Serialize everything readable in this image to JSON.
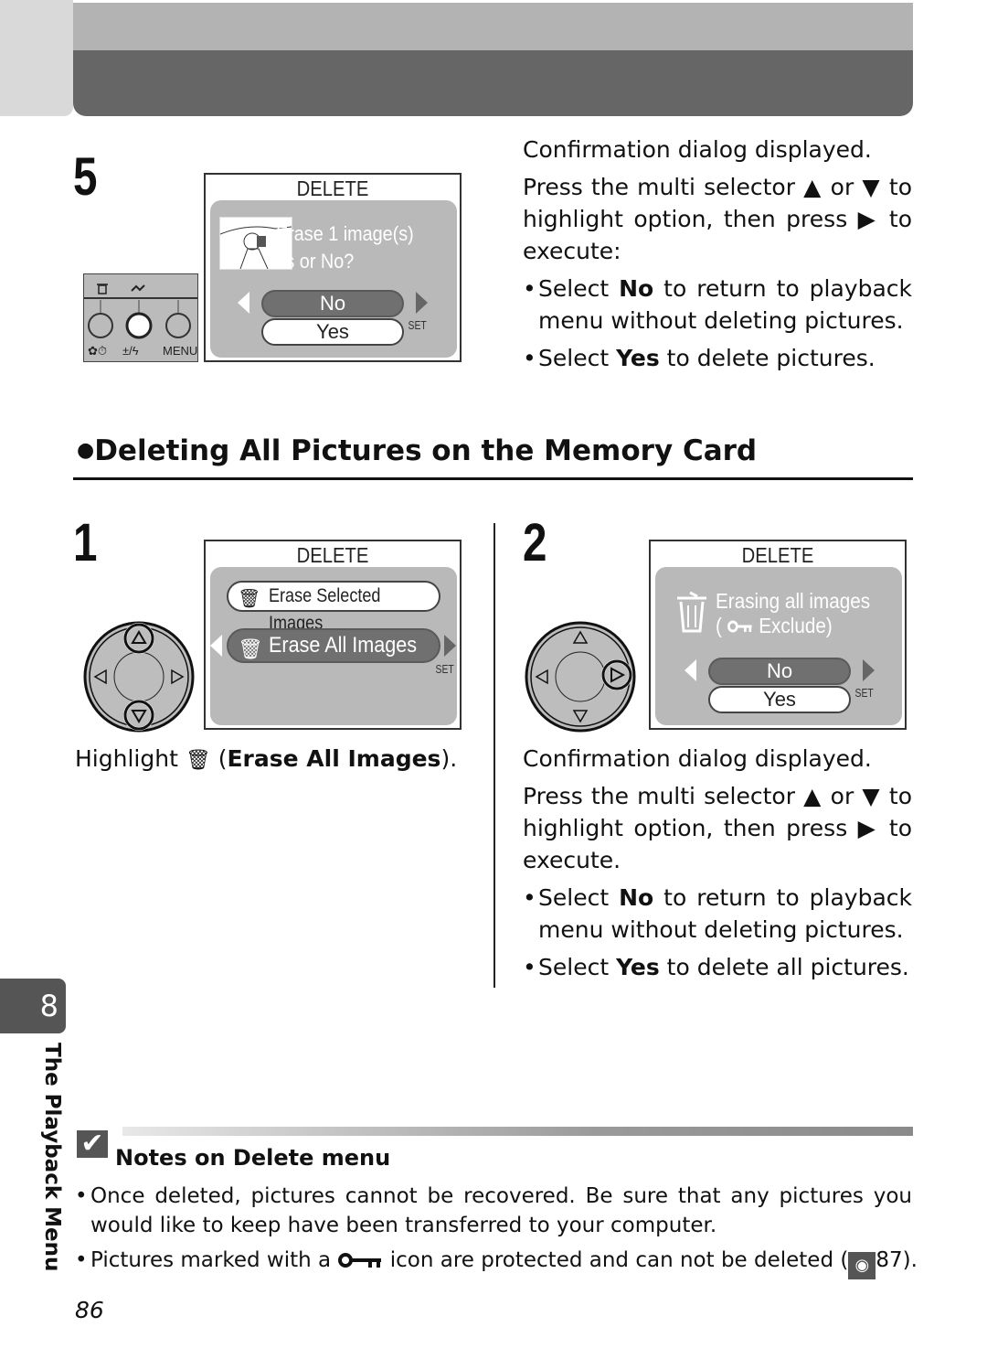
{
  "page": {
    "page_number": "86",
    "chapter_tab": "8",
    "chapter_label": "The Playback Menu"
  },
  "step5": {
    "number": "5",
    "lcd": {
      "title": "DELETE",
      "line1": "Erase 1 image(s)",
      "line2": "Yes or No?",
      "option_no": "No",
      "option_yes": "Yes",
      "set_label": "SET",
      "selected": "No"
    },
    "camera_buttons": {
      "top_icons": [
        "trash-icon",
        "transfer-icon"
      ],
      "bottom_labels": [
        "✿⏱",
        "±/ϟ",
        "MENU"
      ]
    },
    "text": {
      "line1": "Confirmation dialog displayed.",
      "line2": "Press the multi selector ▲ or ▼ to",
      "line3": "highlight option, then press ▶ to",
      "line4": "execute:",
      "bullet1_pre": "Select ",
      "bullet1_bold": "No",
      "bullet1_post": " to return to playback",
      "bullet1_cont": "menu without deleting pictures.",
      "bullet2_pre": "Select ",
      "bullet2_bold": "Yes",
      "bullet2_post": " to delete pictures."
    }
  },
  "section": {
    "heading": "Deleting All Pictures on the Memory Card"
  },
  "step1": {
    "number": "1",
    "lcd": {
      "title": "DELETE",
      "item1": "Erase Selected Images",
      "item2": "Erase All Images",
      "set_label": "SET",
      "selected": "Erase All Images"
    },
    "text": {
      "pre": "Highlight ",
      "paren_open": " (",
      "bold": "Erase All Images",
      "post": ")."
    }
  },
  "step2": {
    "number": "2",
    "lcd": {
      "title": "DELETE",
      "line1": "Erasing all images",
      "line2": "Exclude)",
      "line2_open": "(",
      "option_no": "No",
      "option_yes": "Yes",
      "set_label": "SET",
      "selected": "No"
    },
    "text": {
      "line1": "Confirmation dialog displayed.",
      "line2": "Press the multi selector ▲ or ▼ to",
      "line3": "highlight option, then press ▶ to",
      "line4": "execute.",
      "bullet1_pre": "Select ",
      "bullet1_bold": "No",
      "bullet1_post": " to return to playback",
      "bullet1_cont": "menu without deleting pictures.",
      "bullet2_pre": "Select ",
      "bullet2_bold": "Yes",
      "bullet2_post": " to delete all pictures."
    }
  },
  "notes": {
    "title": "Notes on Delete menu",
    "check_glyph": "✔",
    "bullet1_line1": "Once deleted, pictures cannot be recovered. Be sure that any pictures you",
    "bullet1_line2": "would like to keep have been transferred to your computer.",
    "bullet2_pre": "Pictures marked with a ",
    "bullet2_mid": " icon are protected and can not be deleted (",
    "bullet2_ref": "87",
    "bullet2_post": ")."
  },
  "colors": {
    "header_light": "#b3b3b3",
    "header_dark": "#666666",
    "lcd_panel": "#b9b9b9",
    "highlight_pill": "#707070"
  }
}
